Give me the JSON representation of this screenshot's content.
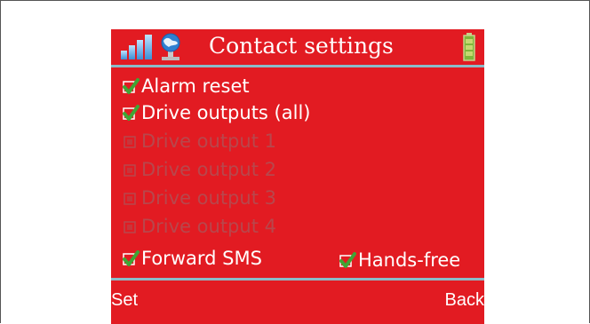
{
  "header": {
    "title": "Contact settings",
    "signal_icon": "signal-bars-icon",
    "network_icon": "network-globe-icon",
    "battery_icon": "battery-icon"
  },
  "options": [
    {
      "label": "Alarm reset",
      "checked": true,
      "enabled": true
    },
    {
      "label": "Drive outputs (all)",
      "checked": true,
      "enabled": true
    },
    {
      "label": "Drive output 1",
      "checked": false,
      "enabled": false
    },
    {
      "label": "Drive output 2",
      "checked": false,
      "enabled": false
    },
    {
      "label": "Drive output 3",
      "checked": false,
      "enabled": false
    },
    {
      "label": "Drive output 4",
      "checked": false,
      "enabled": false
    },
    {
      "label": "Forward SMS",
      "checked": true,
      "enabled": true
    },
    {
      "label": "Hands-free",
      "checked": true,
      "enabled": true
    }
  ],
  "softkeys": {
    "left": "Set",
    "right": "Back"
  },
  "colors": {
    "screen_bg": "#e21b22",
    "divider": "#8bbcc8",
    "check_green": "#3fa535",
    "disabled_text": "#b8474c"
  }
}
